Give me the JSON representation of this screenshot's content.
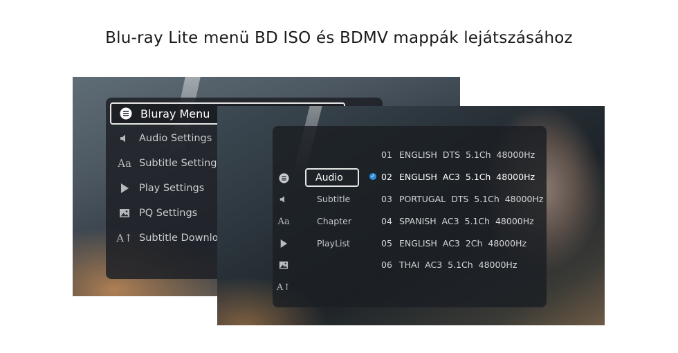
{
  "title": "Blu-ray Lite menü BD ISO és BDMV mappák lejátszásához",
  "bluray_menu": {
    "items": [
      {
        "label": "Bluray Menu",
        "icon": "list-icon",
        "active": true
      },
      {
        "label": "Audio Settings",
        "icon": "speaker-icon",
        "active": false
      },
      {
        "label": "Subtitle Settings",
        "icon": "subtitle-icon",
        "active": false
      },
      {
        "label": "Play Settings",
        "icon": "play-icon",
        "active": false
      },
      {
        "label": "PQ Settings",
        "icon": "picture-icon",
        "active": false
      },
      {
        "label": "Subtitle Download",
        "icon": "subtitle-download-icon",
        "active": false
      }
    ]
  },
  "audio_menu": {
    "side_icons": [
      "list-icon",
      "speaker-icon",
      "subtitle-icon",
      "play-icon",
      "picture-icon",
      "subtitle-download-icon"
    ],
    "categories": [
      {
        "label": "Audio",
        "active": true
      },
      {
        "label": "Subtitle",
        "active": false
      },
      {
        "label": "Chapter",
        "active": false
      },
      {
        "label": "PlayList",
        "active": false
      }
    ],
    "tracks": [
      {
        "num": "01",
        "desc": "ENGLISH  DTS  5.1Ch  48000Hz",
        "selected": false
      },
      {
        "num": "02",
        "desc": "ENGLISH  AC3  5.1Ch  48000Hz",
        "selected": true
      },
      {
        "num": "03",
        "desc": "PORTUGAL  DTS  5.1Ch  48000Hz",
        "selected": false
      },
      {
        "num": "04",
        "desc": "SPANISH  AC3  5.1Ch  48000Hz",
        "selected": false
      },
      {
        "num": "05",
        "desc": "ENGLISH  AC3  2Ch  48000Hz",
        "selected": false
      },
      {
        "num": "06",
        "desc": "THAI  AC3  5.1Ch  48000Hz",
        "selected": false
      }
    ]
  },
  "colors": {
    "selected_check": "#2e8fe0",
    "panel_bg": "#1e2126"
  }
}
